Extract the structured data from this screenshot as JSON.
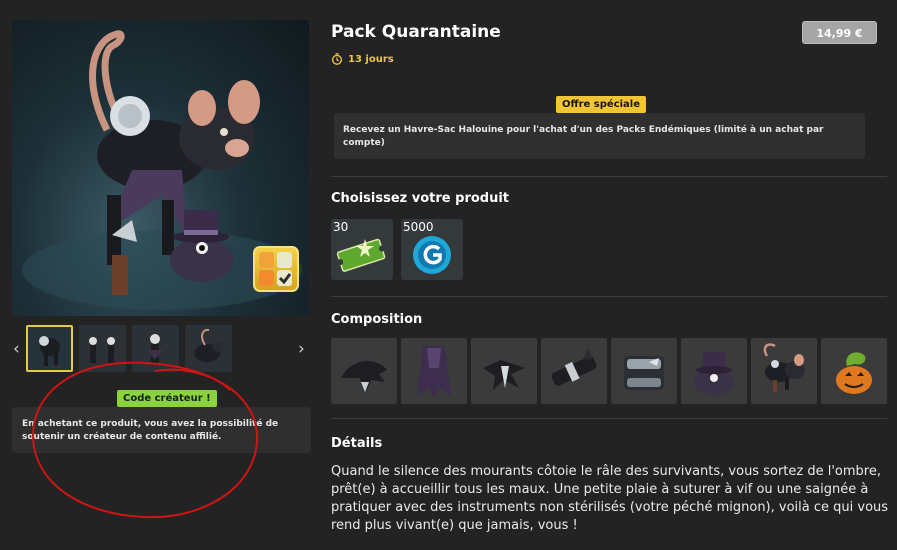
{
  "product": {
    "title": "Pack Quarantaine",
    "timer": "13 jours",
    "price": "14,99 €"
  },
  "offer": {
    "tag": "Offre spéciale",
    "text": "Recevez un Havre-Sac Halouine pour l'achat d'un des Packs Endémiques (limité à un achat par compte)"
  },
  "choose": {
    "heading": "Choisissez votre produit",
    "options": [
      {
        "qty": "30",
        "icon": "green-ticket-icon"
      },
      {
        "qty": "5000",
        "icon": "blue-g-coin-icon"
      }
    ]
  },
  "composition": {
    "heading": "Composition",
    "items": [
      "dark-shoulderpad-icon",
      "purple-cape-icon",
      "silver-claw-icon",
      "dark-bracer-icon",
      "armor-chest-icon",
      "top-hat-creature-icon",
      "rat-pet-icon",
      "pumpkin-pet-icon"
    ]
  },
  "creator": {
    "tag": "Code créateur !",
    "text": "En achetant ce produit, vous avez la possibilité de soutenir un créateur de contenu affilié."
  },
  "details": {
    "heading": "Détails",
    "text": "Quand le silence des mourants côtoie le râle des survivants, vous sortez de l'ombre, prêt(e) à accueillir tous les maux. Une petite plaie à suturer à vif ou une saignée à pratiquer avec des instruments non stérilisés (votre péché mignon), voilà ce qui vous rend plus vivant(e) que jamais, vous !"
  },
  "gallery": {
    "thumbnails": [
      "thumbnail-1",
      "thumbnail-2",
      "thumbnail-3",
      "thumbnail-4"
    ],
    "active_index": 0
  },
  "colors": {
    "background": "#232323",
    "accent_yellow": "#f2c536",
    "accent_green": "#8ad23e",
    "annotation_red": "#d01414"
  }
}
